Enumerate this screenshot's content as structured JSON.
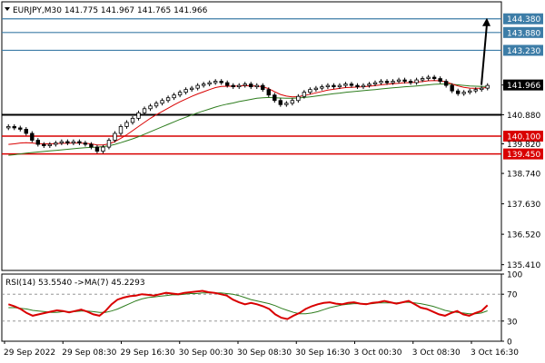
{
  "chart_data": [
    {
      "type": "candlestick",
      "title": "EURJPY,M30  141.775 141.967 141.765 141.966",
      "ylim": [
        135.2,
        145.0
      ],
      "y_ticks": [
        {
          "value": 141.966,
          "label": "141.966",
          "badge": true,
          "badge_color": "#000000"
        },
        {
          "value": 140.88,
          "label": "140.880",
          "badge": false
        },
        {
          "value": 139.82,
          "label": "139.820",
          "badge": false
        },
        {
          "value": 138.74,
          "label": "138.740",
          "badge": false
        },
        {
          "value": 137.63,
          "label": "137.630",
          "badge": false
        },
        {
          "value": 136.52,
          "label": "136.520",
          "badge": false
        },
        {
          "value": 135.41,
          "label": "135.410",
          "badge": false
        }
      ],
      "levels": [
        {
          "value": 144.38,
          "label": "144.380",
          "color": "#3d7da7",
          "width": 1.2
        },
        {
          "value": 143.88,
          "label": "143.880",
          "color": "#3d7da7",
          "width": 1.2
        },
        {
          "value": 143.23,
          "label": "143.230",
          "color": "#3d7da7",
          "width": 1.2
        },
        {
          "value": 140.88,
          "label": "",
          "color": "#000000",
          "width": 2
        },
        {
          "value": 140.1,
          "label": "140.100",
          "color": "#d90000",
          "width": 1.5
        },
        {
          "value": 139.45,
          "label": "139.450",
          "color": "#d90000",
          "width": 1.5
        }
      ],
      "x_labels": [
        "29 Sep 2022",
        "29 Sep 08:30",
        "29 Sep 16:30",
        "30 Sep 00:30",
        "30 Sep 08:30",
        "30 Sep 16:30",
        "3 Oct 00:30",
        "3 Oct 08:30",
        "3 Oct 16:30"
      ],
      "close_series": [
        140.45,
        140.4,
        140.35,
        140.2,
        139.95,
        139.8,
        139.75,
        139.8,
        139.85,
        139.9,
        139.85,
        139.9,
        139.85,
        139.8,
        139.7,
        139.55,
        139.7,
        139.95,
        140.2,
        140.45,
        140.6,
        140.75,
        140.95,
        141.1,
        141.2,
        141.3,
        141.4,
        141.5,
        141.6,
        141.7,
        141.8,
        141.85,
        141.95,
        142.0,
        142.05,
        142.1,
        142.05,
        141.95,
        141.9,
        141.95,
        142.0,
        141.9,
        141.95,
        141.8,
        141.6,
        141.4,
        141.25,
        141.3,
        141.4,
        141.55,
        141.7,
        141.8,
        141.85,
        141.9,
        141.95,
        141.9,
        141.95,
        142.0,
        141.95,
        141.9,
        141.95,
        142.0,
        142.05,
        142.1,
        142.05,
        142.1,
        142.15,
        142.1,
        142.05,
        142.15,
        142.2,
        142.25,
        142.2,
        142.1,
        141.95,
        141.75,
        141.65,
        141.7,
        141.75,
        141.8,
        141.85,
        141.95
      ],
      "fast_ma": [
        139.8,
        139.82,
        139.85,
        139.86,
        139.85,
        139.83,
        139.82,
        139.82,
        139.83,
        139.84,
        139.84,
        139.85,
        139.85,
        139.84,
        139.82,
        139.78,
        139.78,
        139.82,
        139.9,
        140.02,
        140.15,
        140.3,
        140.45,
        140.6,
        140.75,
        140.88,
        141.0,
        141.12,
        141.24,
        141.35,
        141.45,
        141.55,
        141.64,
        141.72,
        141.8,
        141.87,
        141.91,
        141.92,
        141.92,
        141.93,
        141.94,
        141.93,
        141.93,
        141.9,
        141.83,
        141.72,
        141.62,
        141.56,
        141.53,
        141.54,
        141.58,
        141.63,
        141.68,
        141.73,
        141.78,
        141.81,
        141.84,
        141.87,
        141.88,
        141.89,
        141.9,
        141.92,
        141.94,
        141.97,
        141.99,
        142.01,
        142.03,
        142.05,
        142.05,
        142.07,
        142.09,
        142.12,
        142.13,
        142.12,
        142.08,
        142.0,
        141.93,
        141.88,
        141.85,
        141.84,
        141.85,
        141.88
      ],
      "slow_ma": [
        139.4,
        139.42,
        139.45,
        139.48,
        139.5,
        139.52,
        139.54,
        139.56,
        139.58,
        139.6,
        139.62,
        139.64,
        139.66,
        139.68,
        139.69,
        139.7,
        139.72,
        139.75,
        139.8,
        139.86,
        139.93,
        140.0,
        140.08,
        140.17,
        140.26,
        140.35,
        140.44,
        140.53,
        140.62,
        140.71,
        140.79,
        140.87,
        140.95,
        141.02,
        141.09,
        141.16,
        141.22,
        141.27,
        141.31,
        141.36,
        141.4,
        141.44,
        141.48,
        141.5,
        141.51,
        141.5,
        141.49,
        141.48,
        141.48,
        141.49,
        141.51,
        141.53,
        141.56,
        141.59,
        141.62,
        141.65,
        141.67,
        141.7,
        141.72,
        141.74,
        141.76,
        141.78,
        141.8,
        141.82,
        141.84,
        141.86,
        141.88,
        141.9,
        141.91,
        141.93,
        141.95,
        141.97,
        141.99,
        142.0,
        142.0,
        141.99,
        141.97,
        141.95,
        141.93,
        141.92,
        141.91,
        141.91
      ],
      "projection": {
        "from": 141.966,
        "to": 144.38
      }
    },
    {
      "type": "line",
      "title": "RSI(14) 53.5540  ->MA(7) 45.2293",
      "ylim": [
        0,
        100
      ],
      "y_ticks": [
        {
          "value": 100,
          "label": "100"
        },
        {
          "value": 70,
          "label": "70"
        },
        {
          "value": 30,
          "label": "30"
        },
        {
          "value": 0,
          "label": "0"
        }
      ],
      "levels": [
        {
          "value": 70,
          "label": ""
        },
        {
          "value": 30,
          "label": ""
        }
      ],
      "rsi": [
        55,
        52,
        48,
        42,
        38,
        40,
        42,
        44,
        46,
        45,
        43,
        45,
        47,
        44,
        40,
        38,
        45,
        55,
        62,
        65,
        67,
        68,
        70,
        69,
        68,
        70,
        72,
        71,
        70,
        72,
        73,
        74,
        75,
        73,
        72,
        70,
        68,
        62,
        58,
        55,
        57,
        55,
        52,
        48,
        40,
        35,
        33,
        38,
        42,
        48,
        52,
        55,
        57,
        58,
        56,
        55,
        57,
        58,
        56,
        55,
        57,
        58,
        60,
        58,
        56,
        58,
        60,
        55,
        50,
        48,
        44,
        40,
        38,
        42,
        45,
        40,
        38,
        42,
        45,
        53.55
      ],
      "rsi_ma": [
        50,
        50,
        49,
        48,
        46,
        45,
        44,
        43,
        43,
        44,
        44,
        44,
        45,
        45,
        44,
        43,
        43,
        45,
        48,
        52,
        56,
        60,
        63,
        65,
        66,
        67,
        68,
        69,
        69,
        70,
        71,
        71,
        72,
        72,
        72,
        72,
        71,
        70,
        68,
        65,
        62,
        60,
        58,
        56,
        53,
        49,
        46,
        43,
        41,
        41,
        42,
        44,
        47,
        50,
        52,
        54,
        55,
        56,
        56,
        56,
        56,
        57,
        57,
        57,
        57,
        58,
        58,
        57,
        56,
        54,
        52,
        49,
        46,
        44,
        43,
        42,
        41,
        41,
        42,
        45.23
      ]
    }
  ]
}
